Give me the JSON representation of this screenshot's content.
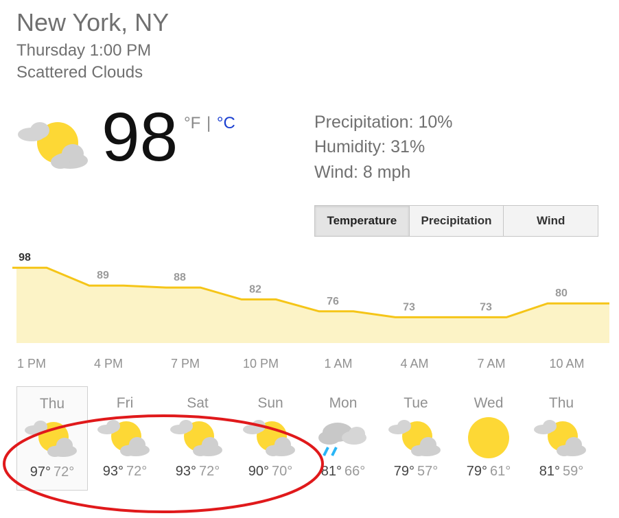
{
  "location": "New York, NY",
  "datetime": "Thursday 1:00 PM",
  "condition": "Scattered Clouds",
  "current": {
    "temperature": "98",
    "unit_f": "°F",
    "unit_sep": "|",
    "unit_c": "°C",
    "icon": "partly-cloudy-icon"
  },
  "details": {
    "precipitation": "Precipitation: 10%",
    "humidity": "Humidity: 31%",
    "wind": "Wind: 8 mph"
  },
  "tabs": [
    "Temperature",
    "Precipitation",
    "Wind"
  ],
  "active_tab": "Temperature",
  "colors": {
    "accent": "#f5c518",
    "fill": "#fcf3c6",
    "link": "#1a3fd0",
    "annotation": "#e0191b"
  },
  "chart_data": {
    "type": "area",
    "x": [
      "1 PM",
      "4 PM",
      "7 PM",
      "10 PM",
      "1 AM",
      "4 AM",
      "7 AM",
      "10 AM"
    ],
    "tick_labels": [
      "1 PM",
      "4 PM",
      "7 PM",
      "10 PM",
      "1 AM",
      "4 AM",
      "7 AM",
      "10 AM"
    ],
    "values": [
      98,
      89,
      88,
      82,
      76,
      73,
      73,
      80
    ],
    "data_labels": [
      "98",
      "89",
      "88",
      "82",
      "76",
      "73",
      "73",
      "80"
    ],
    "ylim": [
      60,
      105
    ],
    "title": "",
    "xlabel": "",
    "ylabel": "",
    "grid": false
  },
  "days": [
    {
      "name": "Thu",
      "hi": "97°",
      "lo": "72°",
      "icon": "partly-cloudy-icon",
      "selected": true
    },
    {
      "name": "Fri",
      "hi": "93°",
      "lo": "72°",
      "icon": "partly-cloudy-icon",
      "selected": false
    },
    {
      "name": "Sat",
      "hi": "93°",
      "lo": "72°",
      "icon": "partly-cloudy-icon",
      "selected": false
    },
    {
      "name": "Sun",
      "hi": "90°",
      "lo": "70°",
      "icon": "partly-cloudy-icon",
      "selected": false
    },
    {
      "name": "Mon",
      "hi": "81°",
      "lo": "66°",
      "icon": "rain-icon",
      "selected": false
    },
    {
      "name": "Tue",
      "hi": "79°",
      "lo": "57°",
      "icon": "partly-cloudy-icon",
      "selected": false
    },
    {
      "name": "Wed",
      "hi": "79°",
      "lo": "61°",
      "icon": "sunny-icon",
      "selected": false
    },
    {
      "name": "Thu",
      "hi": "81°",
      "lo": "59°",
      "icon": "partly-cloudy-icon",
      "selected": false
    }
  ],
  "annotation": "red-ellipse-highlight"
}
